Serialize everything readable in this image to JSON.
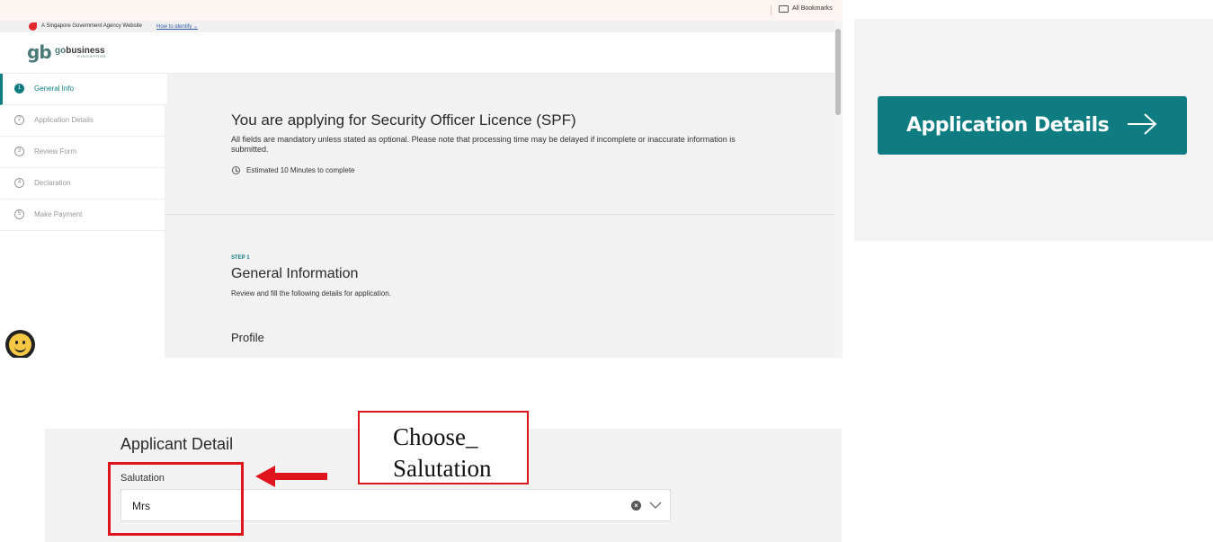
{
  "browser": {
    "bookmarks_label": "All Bookmarks"
  },
  "gov_banner": {
    "text": "A Singapore Government Agency Website",
    "link": "How to identify"
  },
  "logo": {
    "mark": "gb",
    "word_prefix": "go",
    "word_suffix": "business",
    "sub": "SINGAPORE"
  },
  "sidebar": {
    "steps": [
      {
        "num": "1",
        "label": "General Info",
        "active": true
      },
      {
        "num": "2",
        "label": "Application Details",
        "active": false
      },
      {
        "num": "3",
        "label": "Review Form",
        "active": false
      },
      {
        "num": "4",
        "label": "Declaration",
        "active": false
      },
      {
        "num": "5",
        "label": "Make Payment",
        "active": false
      }
    ]
  },
  "main": {
    "title": "You are applying for Security Officer Licence (SPF)",
    "description": "All fields are mandatory unless stated as optional. Please note that processing time may be delayed if incomplete or inaccurate information is submitted.",
    "estimate": "Estimated 10 Minutes to complete",
    "step_tag": "STEP 1",
    "section_title": "General Information",
    "section_desc": "Review and fill the following details for application.",
    "profile_title": "Profile"
  },
  "button_panel": {
    "label": "Application Details"
  },
  "applicant": {
    "title": "Applicant Detail",
    "salutation_label": "Salutation",
    "salutation_value": "Mrs"
  },
  "annotation": {
    "line1": "Choose_",
    "line2": "Salutation"
  },
  "colors": {
    "brand_teal": "#0e7c80",
    "annotation_red": "#e0141c"
  }
}
